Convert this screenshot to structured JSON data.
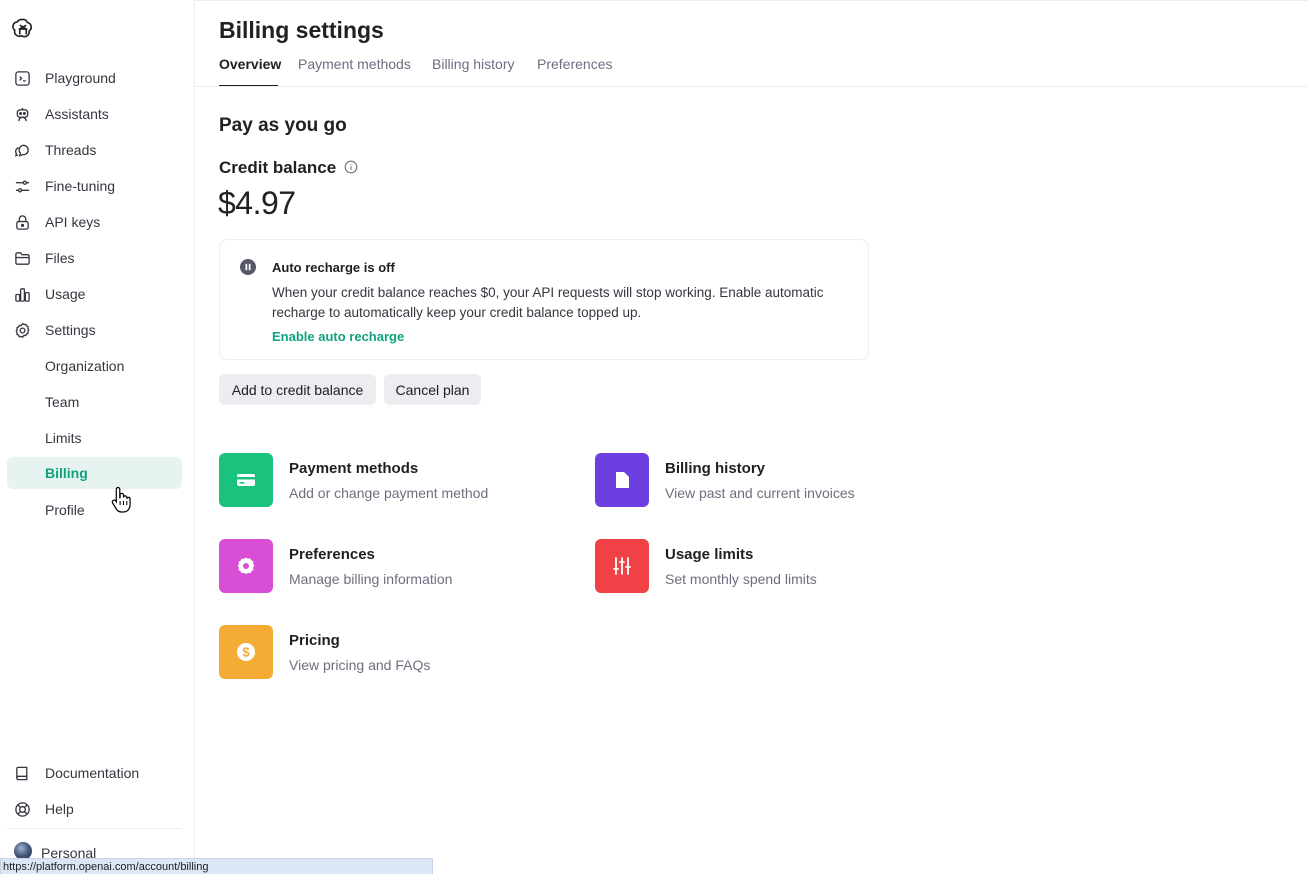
{
  "sidebar": {
    "items": [
      {
        "label": "Playground",
        "icon": "terminal-icon"
      },
      {
        "label": "Assistants",
        "icon": "robot-icon"
      },
      {
        "label": "Threads",
        "icon": "chat-bubbles-icon"
      },
      {
        "label": "Fine-tuning",
        "icon": "sliders-icon"
      },
      {
        "label": "API keys",
        "icon": "lock-icon"
      },
      {
        "label": "Files",
        "icon": "folder-icon"
      },
      {
        "label": "Usage",
        "icon": "bar-chart-icon"
      },
      {
        "label": "Settings",
        "icon": "gear-icon"
      }
    ],
    "settings_sub": [
      {
        "label": "Organization"
      },
      {
        "label": "Team"
      },
      {
        "label": "Limits"
      },
      {
        "label": "Billing",
        "active": true
      },
      {
        "label": "Profile"
      }
    ],
    "bottom": [
      {
        "label": "Documentation",
        "icon": "book-icon"
      },
      {
        "label": "Help",
        "icon": "lifebuoy-icon"
      }
    ],
    "account": "Personal"
  },
  "header": {
    "title": "Billing settings",
    "tabs": [
      {
        "label": "Overview",
        "active": true
      },
      {
        "label": "Payment methods"
      },
      {
        "label": "Billing history"
      },
      {
        "label": "Preferences"
      }
    ]
  },
  "plan": {
    "title": "Pay as you go",
    "credit_label": "Credit balance",
    "credit_amount": "$4.97"
  },
  "notice": {
    "title": "Auto recharge is off",
    "text": "When your credit balance reaches $0, your API requests will stop working. Enable automatic recharge to automatically keep your credit balance topped up.",
    "link": "Enable auto recharge"
  },
  "actions": {
    "add_credit": "Add to credit balance",
    "cancel_plan": "Cancel plan"
  },
  "cards": [
    {
      "title": "Payment methods",
      "desc": "Add or change payment method",
      "color": "#19c37d",
      "icon": "credit-card-icon"
    },
    {
      "title": "Billing history",
      "desc": "View past and current invoices",
      "color": "#6c3fe0",
      "icon": "document-icon"
    },
    {
      "title": "Preferences",
      "desc": "Manage billing information",
      "color": "#d84fd6",
      "icon": "gear-icon"
    },
    {
      "title": "Usage limits",
      "desc": "Set monthly spend limits",
      "color": "#ef4146",
      "icon": "sliders-icon"
    },
    {
      "title": "Pricing",
      "desc": "View pricing and FAQs",
      "color": "#f4ac36",
      "icon": "dollar-icon"
    }
  ],
  "status_url": "https://platform.openai.com/account/billing",
  "colors": {
    "accent": "#10a37f",
    "active_bg": "#e6f3f0",
    "muted_text": "#6e6e80",
    "button_bg": "#ececf1"
  }
}
